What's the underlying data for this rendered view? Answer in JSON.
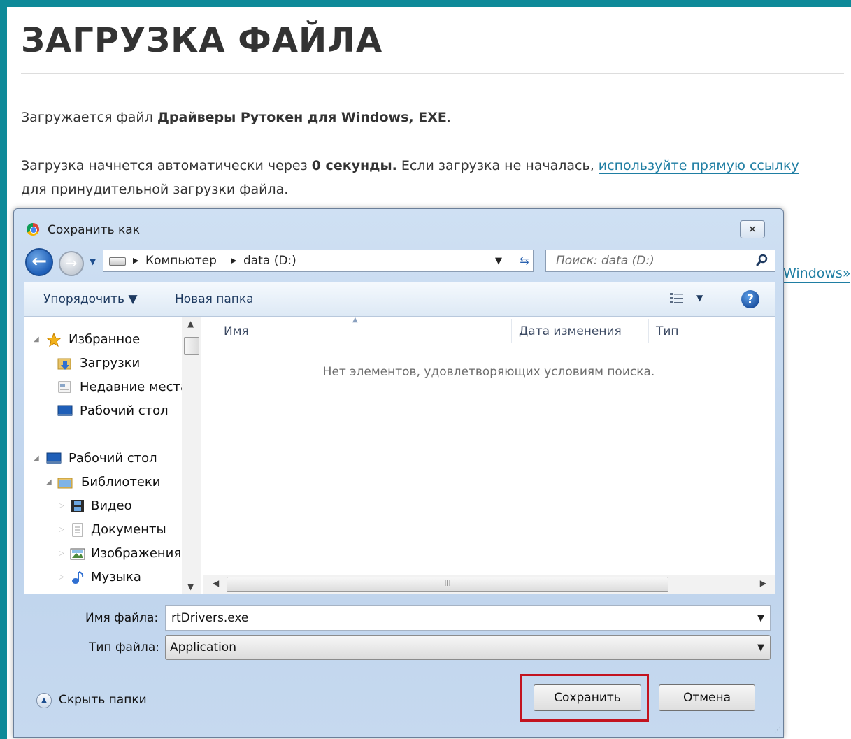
{
  "page": {
    "title": "ЗАГРУЗКА ФАЙЛА",
    "line1_prefix": "Загружается файл ",
    "line1_bold": "Драйверы Рутокен для Windows, EXE",
    "line1_suffix": ".",
    "line2_prefix": "Загрузка начнется автоматически через ",
    "line2_bold": "0 секунды.",
    "line2_middle": " Если загрузка не началась, ",
    "line2_link": "используйте прямую ссылку",
    "line2_suffix": "для принудительной загрузки файла.",
    "peek_link": "Windows»",
    "accent_color": "#0e8a99",
    "link_color": "#1f7ea3"
  },
  "dialog": {
    "title": "Сохранить как",
    "close_icon": "close-icon",
    "breadcrumb": [
      "Компьютер",
      "data (D:)"
    ],
    "search_placeholder": "Поиск: data (D:)",
    "toolbar": {
      "organize": "Упорядочить ▼",
      "new_folder": "Новая папка"
    },
    "nav_tree": [
      {
        "label": "Избранное",
        "icon": "star-icon"
      },
      {
        "label": "Загрузки",
        "icon": "downloads-folder-icon"
      },
      {
        "label": "Недавние места",
        "icon": "recent-places-icon"
      },
      {
        "label": "Рабочий стол",
        "icon": "desktop-icon"
      },
      {
        "label": "Рабочий стол",
        "icon": "desktop-icon"
      },
      {
        "label": "Библиотеки",
        "icon": "libraries-icon"
      },
      {
        "label": "Видео",
        "icon": "video-icon"
      },
      {
        "label": "Документы",
        "icon": "documents-icon"
      },
      {
        "label": "Изображения",
        "icon": "pictures-icon"
      },
      {
        "label": "Музыка",
        "icon": "music-icon"
      }
    ],
    "columns": [
      "Имя",
      "Дата изменения",
      "Тип"
    ],
    "empty_message": "Нет элементов, удовлетворяющих условиям поиска.",
    "scroll_thumb_grip": "III",
    "file_name_label": "Имя файла:",
    "file_name_value": "rtDrivers.exe",
    "file_type_label": "Тип файла:",
    "file_type_value": "Application",
    "hide_folders": "Скрыть папки",
    "save_button": "Сохранить",
    "cancel_button": "Отмена",
    "highlight_color": "#c3131f"
  }
}
